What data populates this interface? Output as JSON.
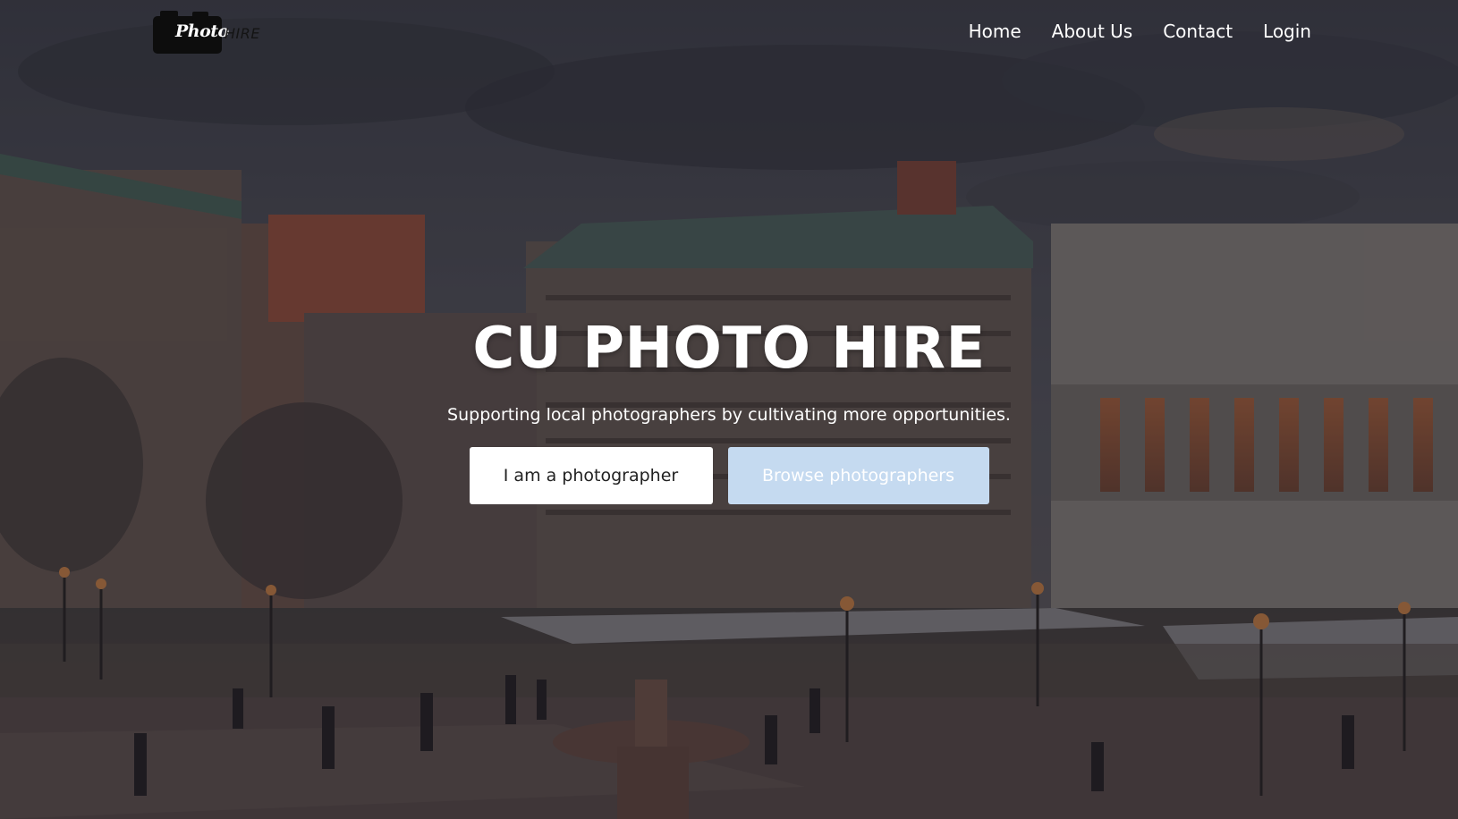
{
  "nav": {
    "logo_text": "Photo",
    "logo_suffix": "HIRE",
    "links": [
      {
        "label": "Home"
      },
      {
        "label": "About Us"
      },
      {
        "label": "Contact"
      },
      {
        "label": "Login"
      }
    ]
  },
  "hero": {
    "title": "CU PHOTO HIRE",
    "subtitle": "Supporting local photographers by cultivating more opportunities.",
    "buttons": {
      "photographer_label": "I am a photographer",
      "browse_label": "Browse photographers"
    },
    "background_image_icon": "campus-photo"
  },
  "colors": {
    "primary_button_bg": "#ffffff",
    "secondary_button_bg": "#c5daf0",
    "text": "#ffffff"
  }
}
